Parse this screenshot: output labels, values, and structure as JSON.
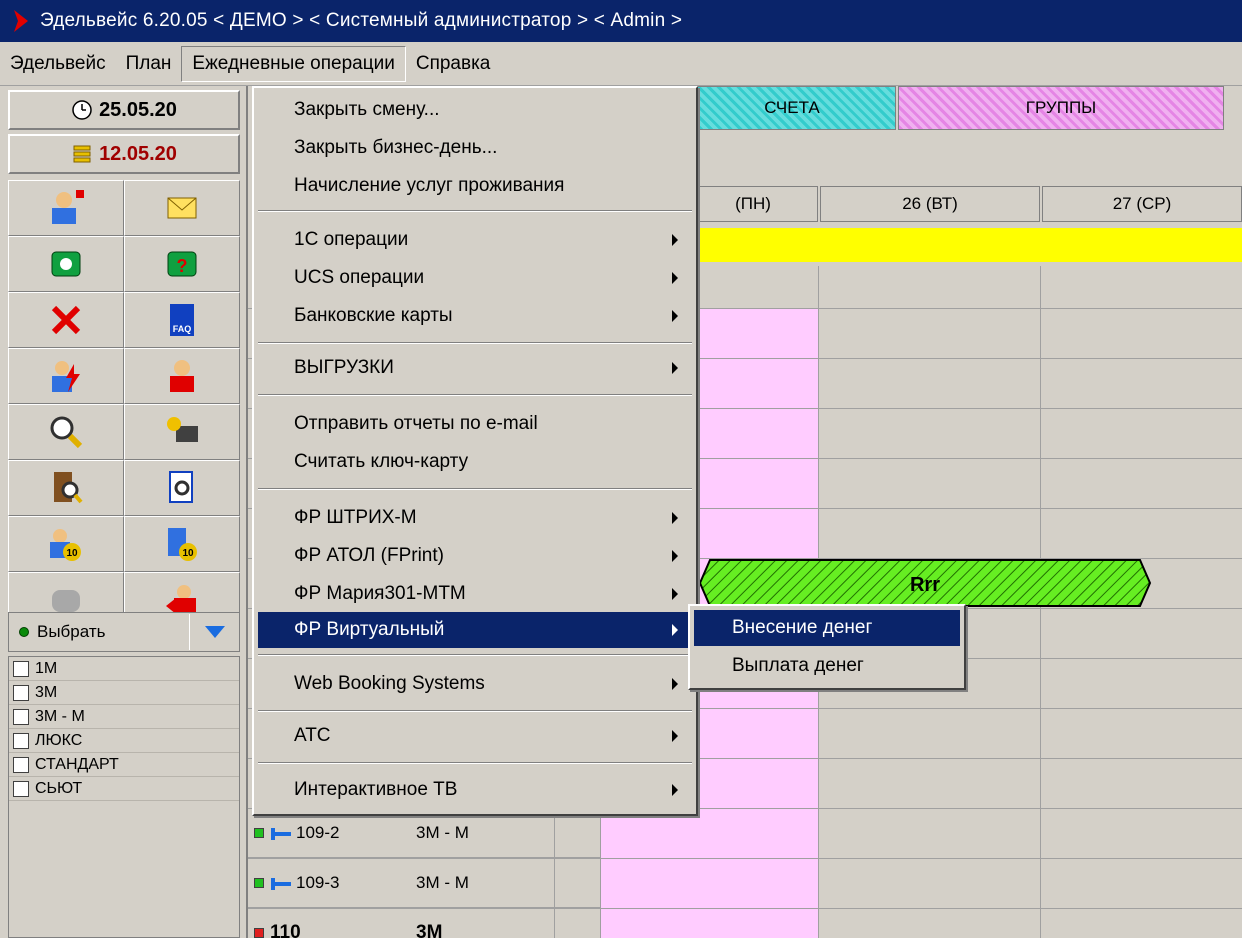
{
  "window": {
    "title": "Эдельвейс 6.20.05 < ДЕМО > < Системный администратор > < Admin >"
  },
  "menubar": [
    "Эдельвейс",
    "План",
    "Ежедневные операции",
    "Справка"
  ],
  "left": {
    "date1": "25.05.20",
    "date2": "12.05.20",
    "select_label": "Выбрать",
    "room_types": [
      "1М",
      "3М",
      "3М - М",
      "ЛЮКС",
      "СТАНДАРТ",
      "СЬЮТ"
    ]
  },
  "grid": {
    "tabs": [
      "СЧЕТА",
      "ГРУППЫ"
    ],
    "headers": [
      "(ПН)",
      "26 (ВТ)",
      "27 (СР)"
    ],
    "booking_label": "Rrr",
    "rooms": [
      {
        "num": "109-2",
        "type": "3М - М"
      },
      {
        "num": "109-3",
        "type": "3М - М"
      },
      {
        "num": "110",
        "type": "3М"
      }
    ]
  },
  "dropdown": {
    "items": [
      "Закрыть смену...",
      "Закрыть бизнес-день...",
      "Начисление услуг проживания",
      "1С операции",
      "UCS операции",
      "Банковские карты",
      "ВЫГРУЗКИ",
      "Отправить отчеты по e-mail",
      "Считать ключ-карту",
      "ФР ШТРИХ-М",
      "ФР АТОЛ (FPrint)",
      "ФР Мария301-МТМ",
      "ФР Виртуальный",
      "Web Booking Systems",
      "АТС",
      "Интерактивное ТВ"
    ]
  },
  "submenu": {
    "items": [
      "Внесение денег",
      "Выплата денег"
    ]
  }
}
